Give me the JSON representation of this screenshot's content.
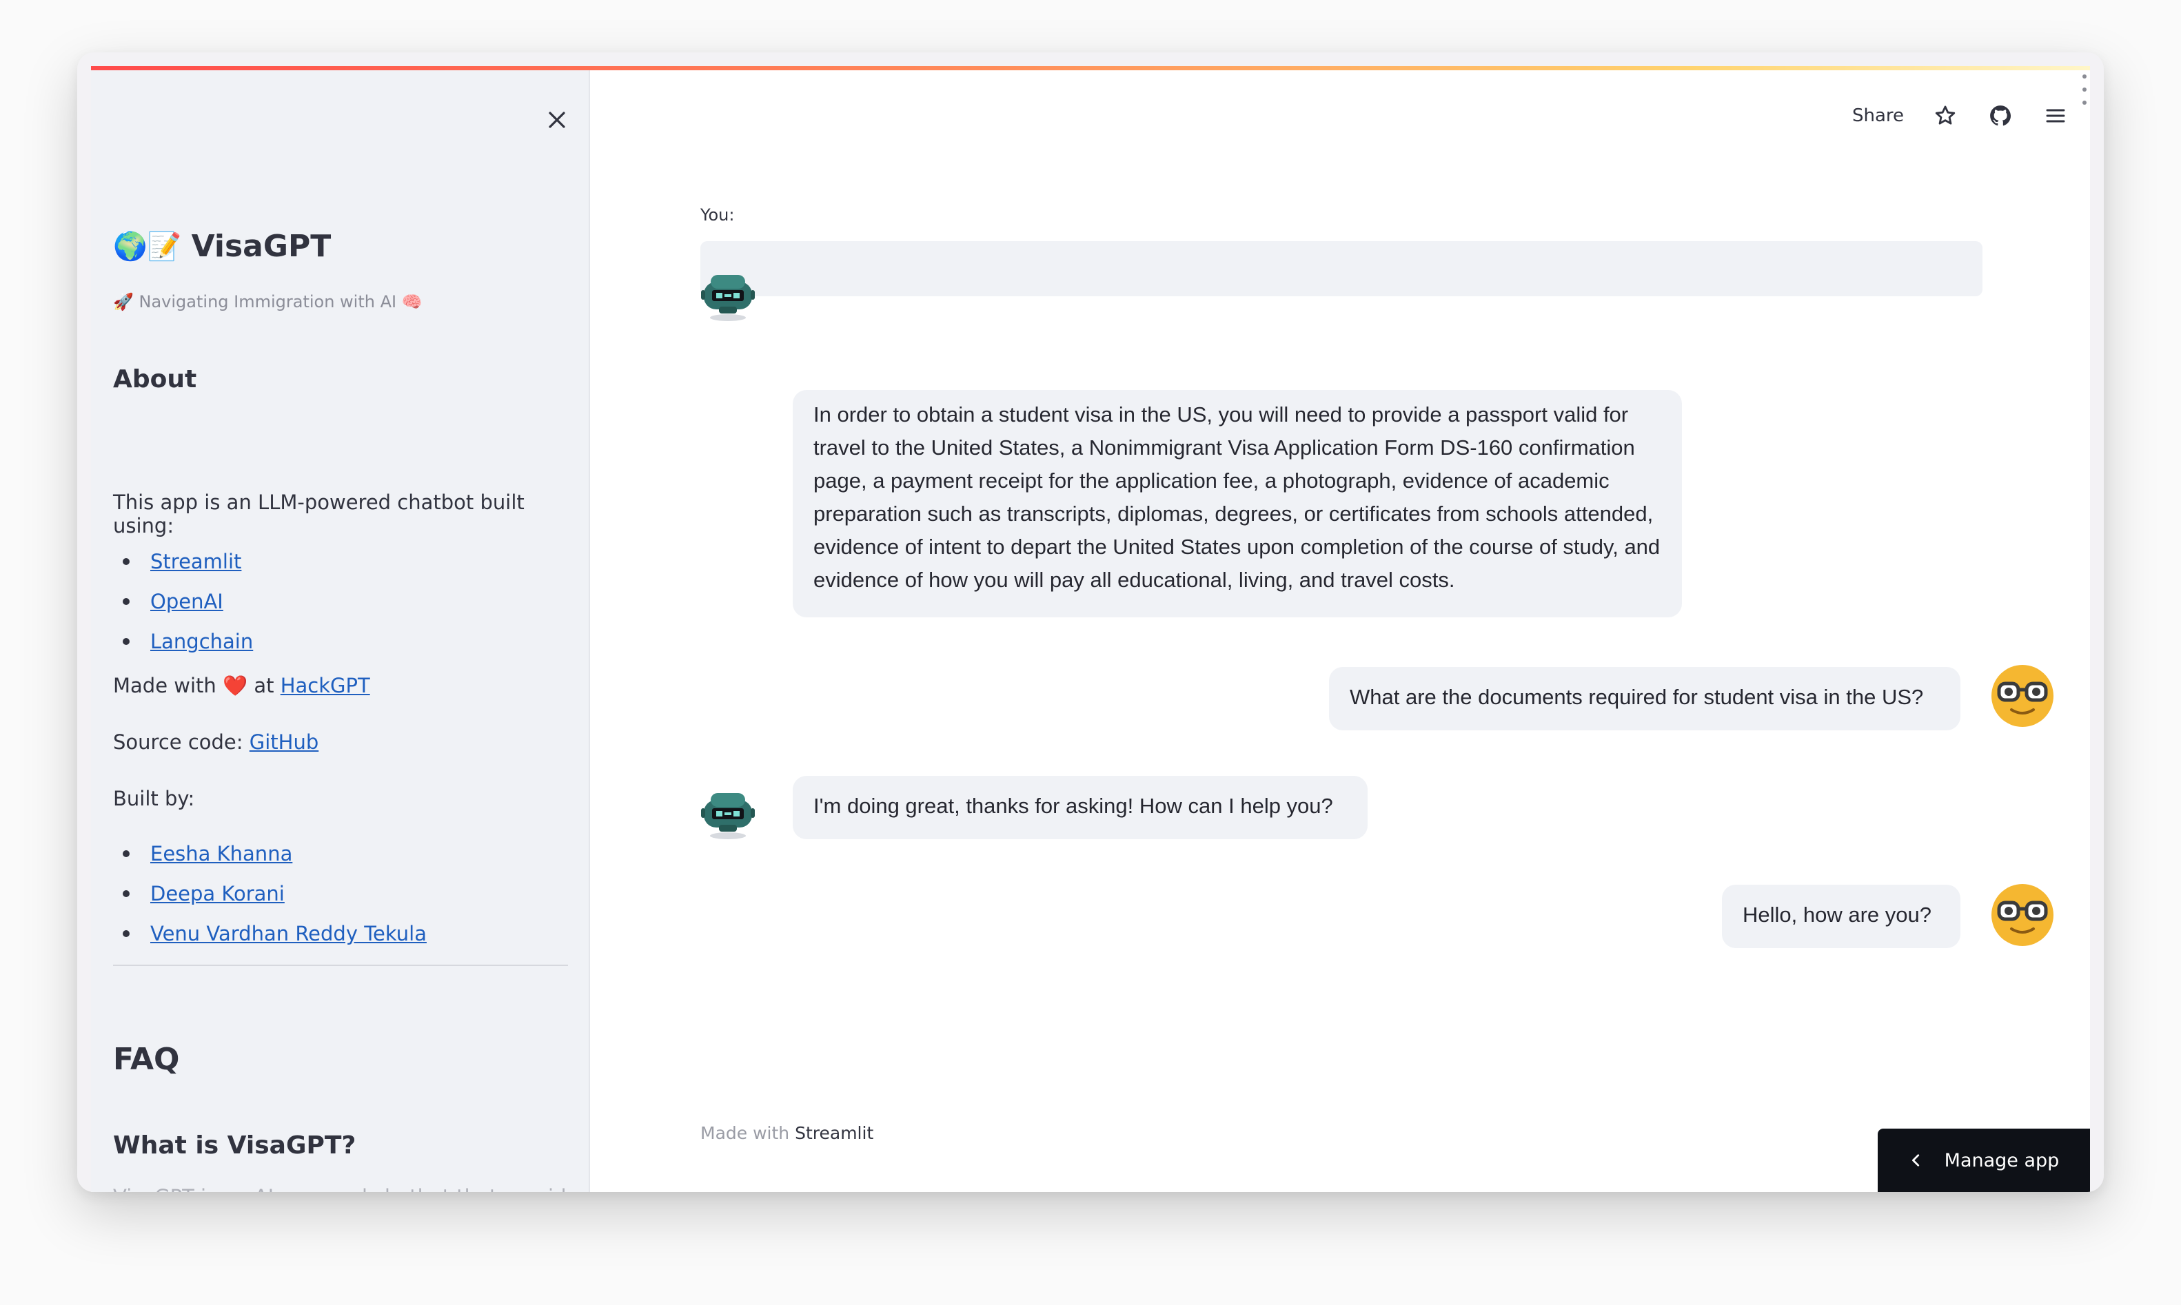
{
  "sidebar": {
    "title": "VisaGPT",
    "title_emojis": "🌍📝",
    "tagline": "🚀 Navigating Immigration with AI 🧠",
    "about_heading": "About",
    "about_text": "This app is an LLM-powered chatbot built using:",
    "tech_links": [
      "Streamlit",
      "OpenAI",
      "Langchain"
    ],
    "made_with_prefix": "Made with ",
    "made_with_heart": "❤️",
    "made_with_at": " at ",
    "made_with_link": "HackGPT",
    "source_prefix": "Source code: ",
    "source_link": "GitHub",
    "built_by_label": "Built by:",
    "authors": [
      "Eesha Khanna",
      "Deepa Korani",
      "Venu Vardhan Reddy Tekula"
    ],
    "faq_heading": "FAQ",
    "faq_q1": "What is VisaGPT?",
    "faq_q1_partial": "VisaGPT is an AI-powered chatbot that provides"
  },
  "header": {
    "share_label": "Share",
    "icons": [
      "star-icon",
      "github-icon",
      "hamburger-menu-icon"
    ]
  },
  "chat": {
    "input_label": "You:",
    "input_value": "",
    "messages": [
      {
        "role": "bot",
        "text": "In order to obtain a student visa in the US, you will need to provide a passport valid for travel to the United States, a Nonimmigrant Visa Application Form DS-160 confirmation page, a payment receipt for the application fee, a photograph, evidence of academic preparation such as transcripts, diplomas, degrees, or certificates from schools attended, evidence of intent to depart the United States upon completion of the course of study, and evidence of how you will pay all educational, living, and travel costs."
      },
      {
        "role": "user",
        "text": "What are the documents required for student visa in the US?"
      },
      {
        "role": "bot",
        "text": "I'm doing great, thanks for asking! How can I help you?"
      },
      {
        "role": "user",
        "text": "Hello, how are you?"
      }
    ]
  },
  "footer": {
    "made_with": "Made with",
    "brand": "Streamlit"
  },
  "manage_app_label": "Manage app",
  "colors": {
    "accent_red": "#ff4b4b",
    "sidebar_bg": "#f0f2f6",
    "link": "#1f5fbf",
    "user_avatar": "#f5b731",
    "bot_avatar": "#2f6f6a"
  }
}
